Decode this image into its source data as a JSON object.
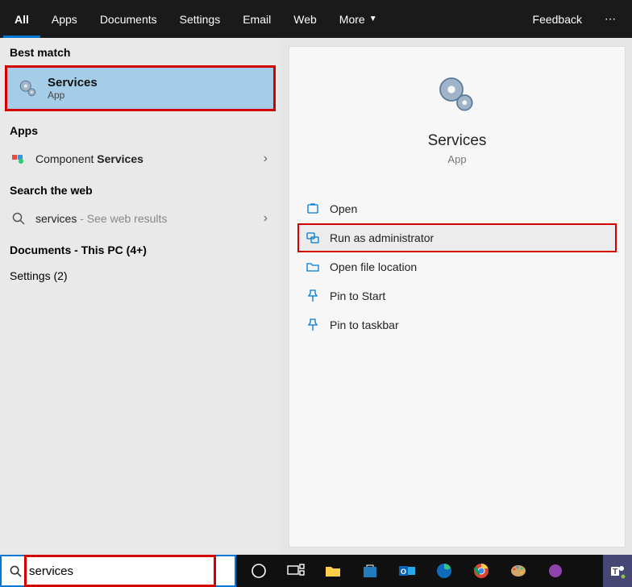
{
  "tabs": {
    "all": "All",
    "apps": "Apps",
    "documents": "Documents",
    "settings": "Settings",
    "email": "Email",
    "web": "Web",
    "more": "More",
    "feedback": "Feedback"
  },
  "left": {
    "best_match": "Best match",
    "services_title": "Services",
    "services_sub": "App",
    "apps_header": "Apps",
    "component_prefix": "Component ",
    "component_bold": "Services",
    "search_web_header": "Search the web",
    "web_query": "services",
    "web_suffix": " - See web results",
    "documents_header": "Documents - This PC (4+)",
    "settings_header": "Settings (2)"
  },
  "detail": {
    "title": "Services",
    "sub": "App",
    "actions": {
      "open": "Open",
      "run_admin": "Run as administrator",
      "open_loc": "Open file location",
      "pin_start": "Pin to Start",
      "pin_taskbar": "Pin to taskbar"
    }
  },
  "search": {
    "value": "services"
  }
}
